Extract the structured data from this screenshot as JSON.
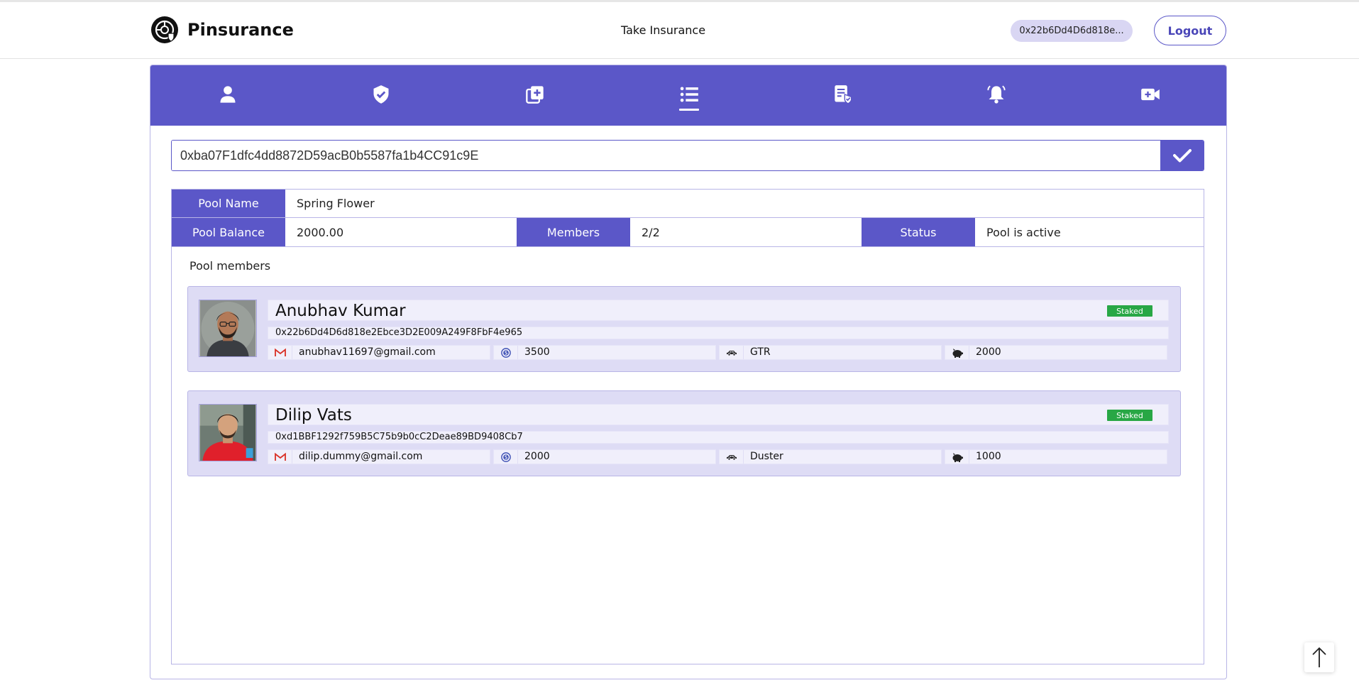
{
  "brand": {
    "name": "Pinsurance"
  },
  "header": {
    "nav_link": "Take Insurance",
    "wallet_address": "0x22b6Dd4D6d818e...",
    "logout_label": "Logout"
  },
  "tabs": [
    {
      "icon": "user-icon"
    },
    {
      "icon": "shield-check-icon"
    },
    {
      "icon": "add-policy-icon"
    },
    {
      "icon": "list-icon",
      "active": true
    },
    {
      "icon": "claim-document-icon"
    },
    {
      "icon": "bell-icon"
    },
    {
      "icon": "video-call-icon"
    }
  ],
  "search": {
    "value": "0xba07F1dfc4dd8872D59acB0b5587fa1b4CC91c9E",
    "submit_icon": "check-icon"
  },
  "pool": {
    "name_label": "Pool Name",
    "name_value": "Spring Flower",
    "balance_label": "Pool Balance",
    "balance_value": "2000.00",
    "members_label": "Members",
    "members_value": "2/2",
    "status_label": "Status",
    "status_value": "Pool is active"
  },
  "members_title": "Pool members",
  "members": [
    {
      "name": "Anubhav Kumar",
      "badge": "Staked",
      "address": "0x22b6Dd4D6d818e2Ebce3D2E009A249F8FbF4e965",
      "email": "anubhav11697@gmail.com",
      "coins": "3500",
      "car": "GTR",
      "stake": "2000"
    },
    {
      "name": "Dilip Vats",
      "badge": "Staked",
      "address": "0xd1BBF1292f759B5C75b9b0cC2Deae89BD9408Cb7",
      "email": "dilip.dummy@gmail.com",
      "coins": "2000",
      "car": "Duster",
      "stake": "1000"
    }
  ],
  "colors": {
    "accent": "#5b57c8",
    "card_bg": "#dedcf5",
    "badge_green": "#28a745",
    "pill_bg": "#d9d6f3"
  }
}
